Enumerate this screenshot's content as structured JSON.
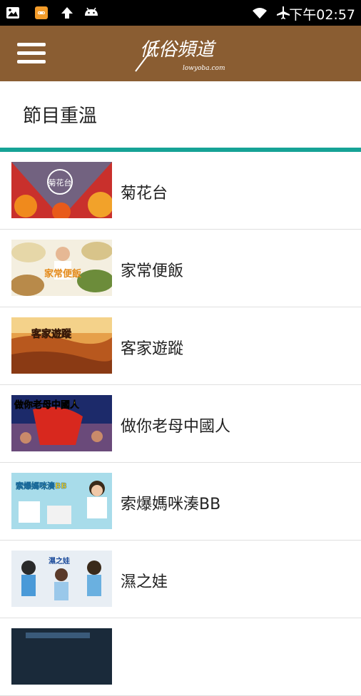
{
  "status_bar": {
    "time": "下午02:57",
    "icons": [
      "image-icon",
      "game-controller-icon",
      "upload-arrow-icon",
      "android-icon",
      "wifi-icon",
      "airplane-mode-icon"
    ]
  },
  "header": {
    "menu_icon": "hamburger-menu-icon",
    "logo_text": "低俗頻道",
    "logo_subtext": "lowyoba.com"
  },
  "section": {
    "title": "節目重溫"
  },
  "accent_color": "#16a396",
  "header_color": "#8a5d32",
  "programs": [
    {
      "label": "菊花台",
      "thumb_text": "菊花台"
    },
    {
      "label": "家常便飯",
      "thumb_text": "家常便飯"
    },
    {
      "label": "客家遊蹤",
      "thumb_text": "客家遊蹤"
    },
    {
      "label": "做你老母中國人",
      "thumb_text": "做你老母中國人"
    },
    {
      "label": "索爆媽咪湊BB",
      "thumb_text": "索爆媽咪湊BB"
    },
    {
      "label": "濕之娃",
      "thumb_text": "濕之娃"
    }
  ]
}
